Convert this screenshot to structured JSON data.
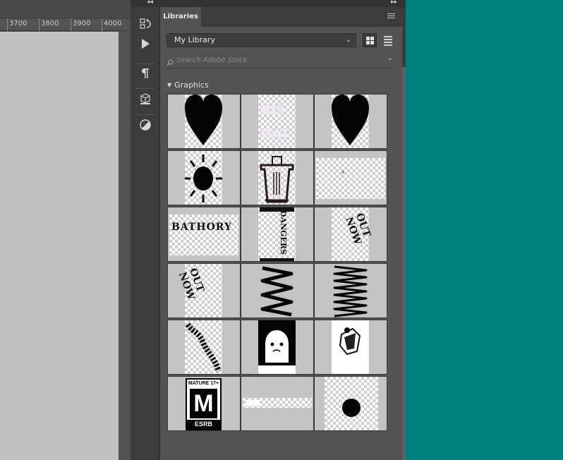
{
  "ruler": {
    "ticks": [
      "3700",
      "3800",
      "3900",
      "4000"
    ]
  },
  "panel": {
    "tab_label": "Libraries",
    "library_name": "My Library",
    "search_placeholder": "Search Adobe Stock",
    "section_title": "Graphics",
    "view_modes": [
      "grid-view-icon",
      "list-view-icon"
    ]
  },
  "tools": [
    "history-icon",
    "play-icon",
    "paragraph-icon",
    "3d-cube-icon",
    "adjustment-icon"
  ],
  "graphics": [
    {
      "name": "heart",
      "label": ""
    },
    {
      "name": "white-cutout-text",
      "label": ""
    },
    {
      "name": "heart",
      "label": ""
    },
    {
      "name": "sun",
      "label": ""
    },
    {
      "name": "cup",
      "label": ""
    },
    {
      "name": "blank-dot",
      "label": ""
    },
    {
      "name": "bathory-text",
      "label": "BATHORY"
    },
    {
      "name": "dangers-text",
      "label": "DANGERS"
    },
    {
      "name": "out-now-text",
      "label": "OUT NOW"
    },
    {
      "name": "out-now-text",
      "label": "OUT NOW"
    },
    {
      "name": "zigzag",
      "label": ""
    },
    {
      "name": "zigzag-dense",
      "label": ""
    },
    {
      "name": "wavy-text",
      "label": ""
    },
    {
      "name": "ghost",
      "label": ""
    },
    {
      "name": "character-sketch",
      "label": ""
    },
    {
      "name": "esrb-badge",
      "label": "MATURE 17+",
      "sub": "ESRB",
      "letter": "M"
    },
    {
      "name": "white-bar",
      "label": ""
    },
    {
      "name": "black-circle",
      "label": ""
    }
  ],
  "colors": {
    "background": "#008080",
    "panel": "#535353",
    "document": "#c0c0c0"
  }
}
